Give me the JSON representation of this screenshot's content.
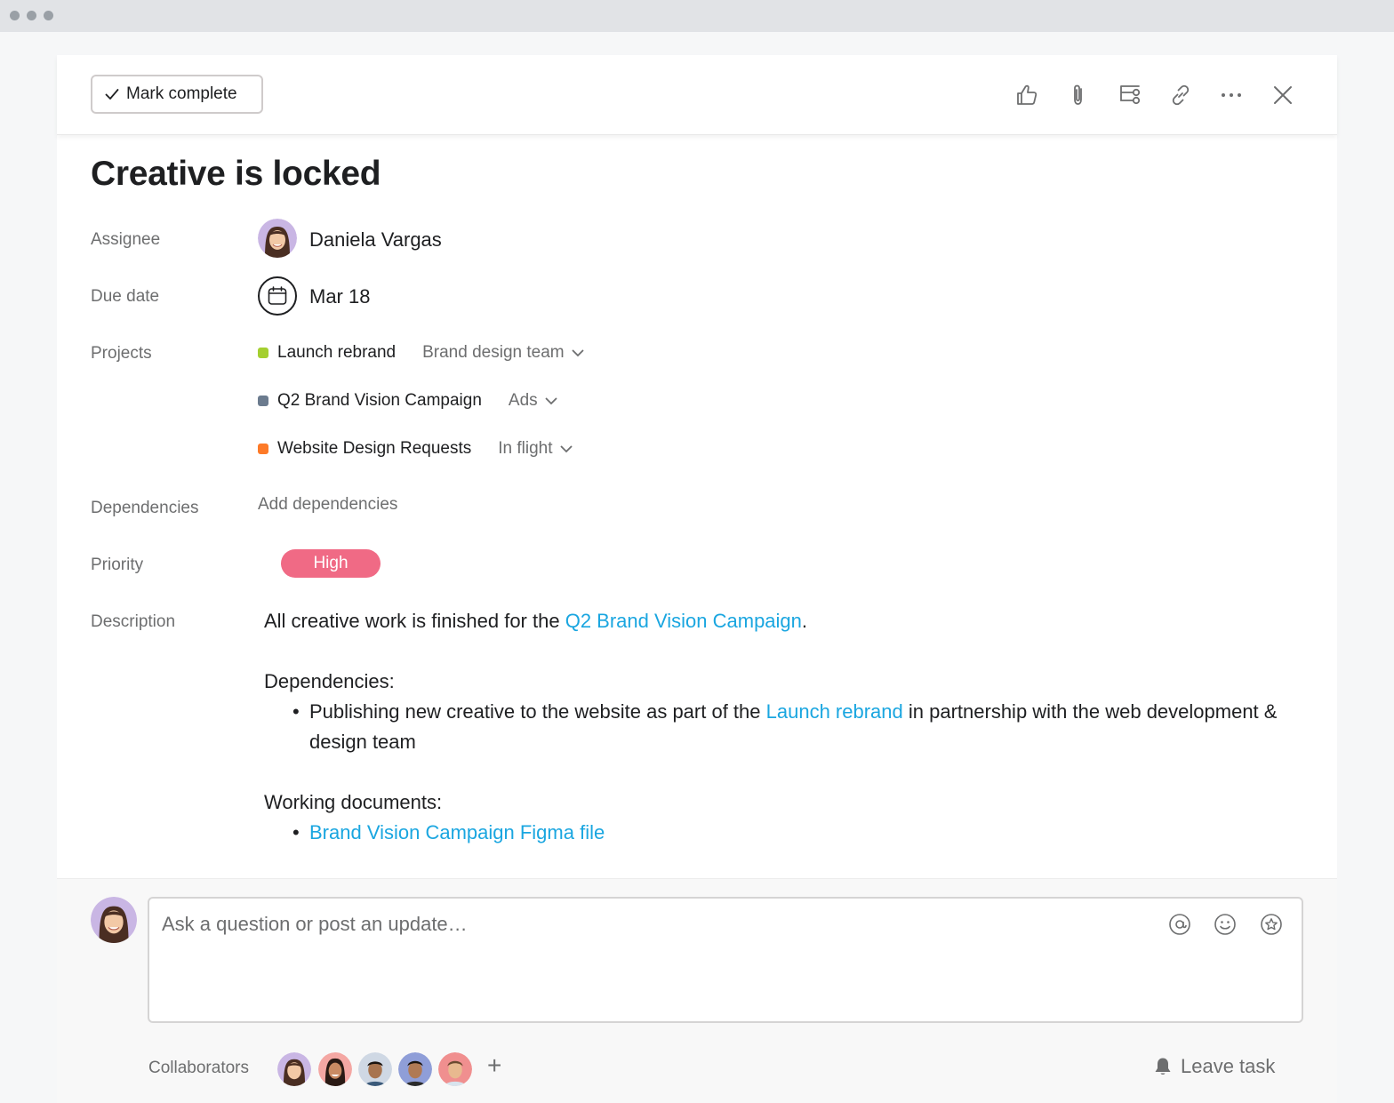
{
  "toolbar": {
    "mark_complete_label": "Mark complete",
    "icons": [
      "thumbs-up-icon",
      "attachment-icon",
      "subtask-icon",
      "link-icon",
      "more-icon",
      "close-icon"
    ]
  },
  "task": {
    "title": "Creative is locked",
    "fields": {
      "assignee_label": "Assignee",
      "assignee_name": "Daniela Vargas",
      "due_label": "Due date",
      "due_value": "Mar 18",
      "projects_label": "Projects",
      "dependencies_label": "Dependencies",
      "add_dependencies": "Add dependencies",
      "priority_label": "Priority",
      "priority_value": "High",
      "description_label": "Description"
    },
    "projects": [
      {
        "name": "Launch rebrand",
        "section": "Brand design team",
        "color": "#a4cf30"
      },
      {
        "name": "Q2 Brand Vision Campaign",
        "section": "Ads",
        "color": "#6b7b8e"
      },
      {
        "name": "Website Design Requests",
        "section": "In flight",
        "color": "#fd7a28"
      }
    ],
    "description": {
      "intro_text": "All creative work is finished for the ",
      "intro_link": "Q2 Brand Vision Campaign",
      "intro_end": ".",
      "dependencies_heading": "Dependencies:",
      "dep_item_text1": "Publishing new creative to the website as part of the ",
      "dep_item_link": "Launch rebrand",
      "dep_item_text2": " in partnership with the web development & design team",
      "docs_heading": "Working documents:",
      "docs_item_link": "Brand Vision Campaign Figma file"
    }
  },
  "comment": {
    "placeholder": "Ask a question or post an update…",
    "collaborators_label": "Collaborators",
    "add_collaborator": "+",
    "leave_task_label": "Leave task"
  },
  "colors": {
    "link": "#1aa6e0",
    "priority_high": "#f06a85"
  }
}
